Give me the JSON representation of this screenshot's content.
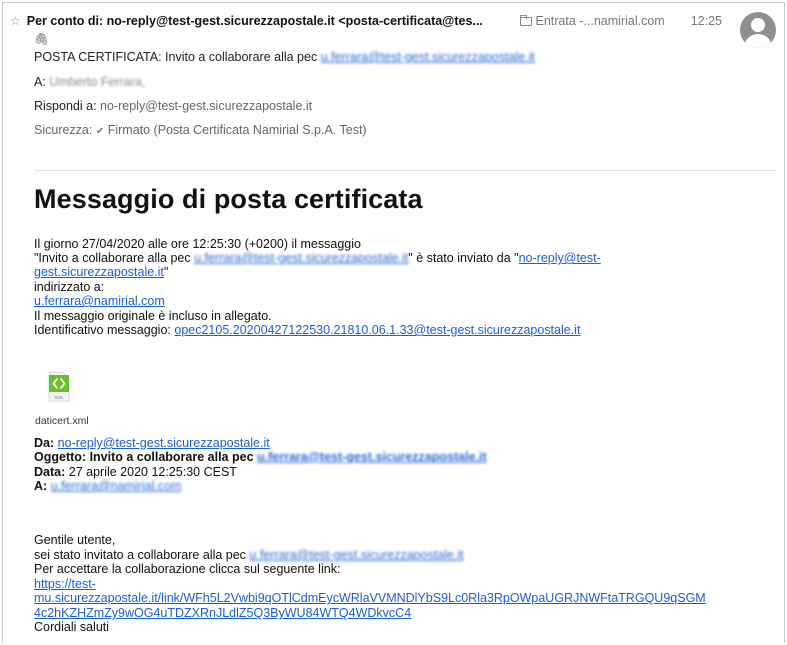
{
  "header": {
    "sender": "Per conto di: no-reply@test-gest.sicurezzapostale.it <posta-certificata@tes...",
    "mailbox": "Entrata -...namirial.com",
    "time": "12:25",
    "subject_label": "POSTA CERTIFICATA: Invito a collaborare alla pec",
    "subject_email": "u.ferrara@test-gest.sicurezzapostale.it",
    "to_label": "A:",
    "to_value": "Umberto Ferrara,",
    "reply_label": "Rispondi a:",
    "reply_value": "no-reply@test-gest.sicurezzapostale.it",
    "security_label": "Sicurezza:",
    "security_value": "Firmato (Posta Certificata Namirial S.p.A. Test)"
  },
  "body": {
    "title": "Messaggio di posta certificata",
    "line1": "Il giorno 27/04/2020 alle ore 12:25:30 (+0200) il messaggio",
    "line2_a": "\"Invito a collaborare alla pec",
    "line2_email": "u.ferrara@test-gest.sicurezzapostale.it",
    "line2_b": "\" è stato inviato da \"",
    "line2_link": "no-reply@test-",
    "line3_link": "gest.sicurezzapostale.it",
    "line3_b": "\"",
    "line4": "indirizzato a:",
    "line5_link": "u.ferrara@namirial.com",
    "line6": "Il messaggio originale è incluso in allegato.",
    "line7_label": "Identificativo messaggio:",
    "line7_link": "opec2105.20200427122530.21810.06.1.33@test-gest.sicurezzapostale.it"
  },
  "attachment": {
    "icon_text": "XML",
    "name": "daticert.xml",
    "icon_color": "#6abf2a"
  },
  "forwarded": {
    "from_label": "Da:",
    "from_link": "no-reply@test-gest.sicurezzapostale.it",
    "subject_label": "Oggetto:",
    "subject_text": "Invito a collaborare alla pec",
    "subject_email": "u.ferrara@test-gest.sicurezzapostale.it",
    "date_label": "Data:",
    "date_value": "27 aprile 2020 12:25:30 CEST",
    "to_label": "A:",
    "to_email": "u.ferrara@namirial.com"
  },
  "message": {
    "greeting": "Gentile utente,",
    "line1_a": "sei stato invitato a collaborare alla pec",
    "line1_email": "u.ferrara@test-gest.sicurezzapostale.it",
    "line2": "Per accettare la collaborazione clicca sul seguente link:",
    "link1": "https://test-",
    "link2": "mu.sicurezzapostale.it/link/WFh5L2Vwbi9qOTlCdmEycWRlaVVMNDlYbS9Lc0Rla3RpOWpaUGRJNWFtaTRGQU9qSGM",
    "link3": "4c2hKZHZmZy9wOG4uTDZXRnJLdlZ5Q3ByWU84WTQ4WDkvcC4",
    "closing": "Cordiali saluti"
  },
  "colors": {
    "link": "#1a5fd6",
    "muted": "#777777",
    "avatar": "#8e8e93"
  }
}
